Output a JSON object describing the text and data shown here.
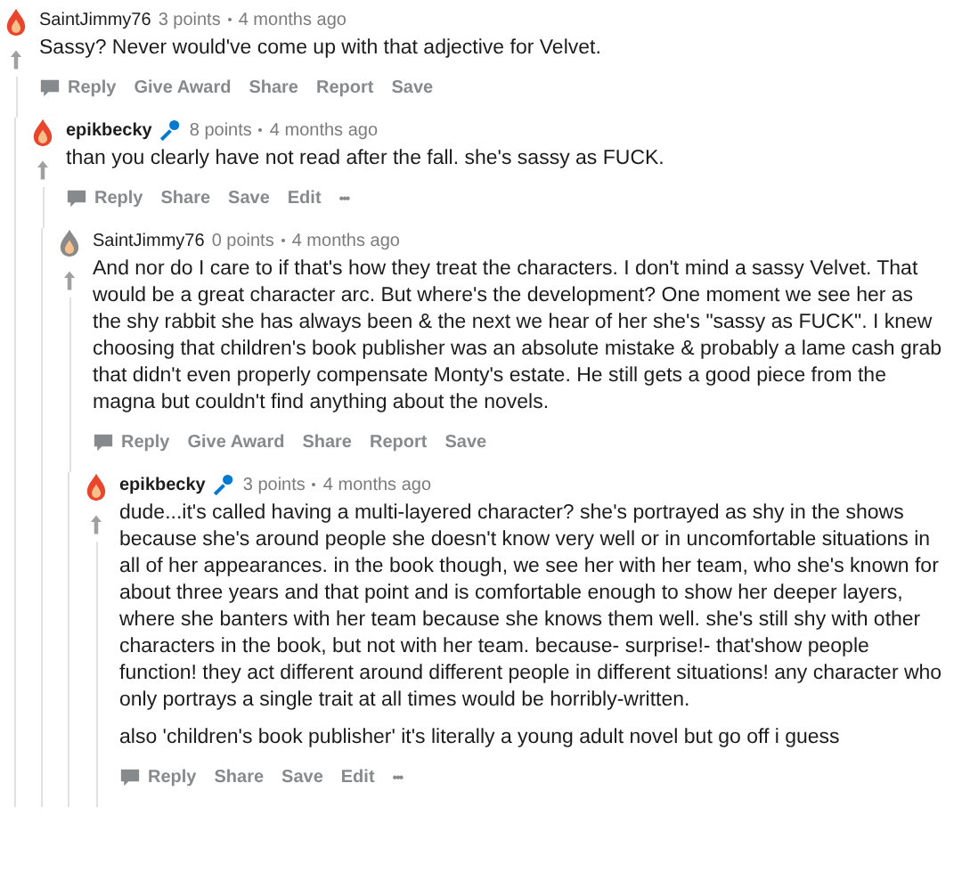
{
  "comments": [
    {
      "author": "SaintJimmy76",
      "is_op": false,
      "color": "#e8452c",
      "points": "3 points",
      "time": "4 months ago",
      "paragraphs": [
        "Sassy? Never would've come up with that adjective for Velvet."
      ],
      "actions": [
        {
          "kind": "reply",
          "label": "Reply"
        },
        {
          "kind": "text",
          "label": "Give Award"
        },
        {
          "kind": "text",
          "label": "Share"
        },
        {
          "kind": "text",
          "label": "Report"
        },
        {
          "kind": "text",
          "label": "Save"
        }
      ],
      "children": [
        {
          "author": "epikbecky",
          "is_op": true,
          "color": "#e8452c",
          "points": "8 points",
          "time": "4 months ago",
          "paragraphs": [
            "than you clearly have not read after the fall. she's sassy as FUCK."
          ],
          "actions": [
            {
              "kind": "reply",
              "label": "Reply"
            },
            {
              "kind": "text",
              "label": "Share"
            },
            {
              "kind": "text",
              "label": "Save"
            },
            {
              "kind": "text",
              "label": "Edit"
            },
            {
              "kind": "more",
              "label": "•••"
            }
          ],
          "children": [
            {
              "author": "SaintJimmy76",
              "is_op": false,
              "color": "#8a8a8a",
              "points": "0 points",
              "time": "4 months ago",
              "paragraphs": [
                "And nor do I care to if that's how they treat the characters. I don't mind a sassy Velvet. That would be a great character arc. But where's the development? One moment we see her as the shy rabbit she has always been & the next we hear of her she's \"sassy as FUCK\". I knew choosing that children's book publisher was an absolute mistake & probably a lame cash grab that didn't even properly compensate Monty's estate. He still gets a good piece from the magna but couldn't find anything about the novels."
              ],
              "actions": [
                {
                  "kind": "reply",
                  "label": "Reply"
                },
                {
                  "kind": "text",
                  "label": "Give Award"
                },
                {
                  "kind": "text",
                  "label": "Share"
                },
                {
                  "kind": "text",
                  "label": "Report"
                },
                {
                  "kind": "text",
                  "label": "Save"
                }
              ],
              "children": [
                {
                  "author": "epikbecky",
                  "is_op": true,
                  "points": "3 points",
                  "time": "4 months ago",
                  "paragraphs": [
                    "dude...it's called having a multi-layered character? she's portrayed as shy in the shows because she's around people she doesn't know very well or in uncomfortable situations in all of her appearances. in the book though, we see her with her team, who she's known for about three years and that point and is comfortable enough to show her deeper layers, where she banters with her team because she knows them well. she's still shy with other characters in the book, but not with her team. because- surprise!- that'show people function! they act different around different people in different situations! any character who only portrays a single trait at all times would be horribly-written.",
                    "also 'children's book publisher' it's literally a young adult novel but go off i guess"
                  ],
                  "actions": [
                    {
                      "kind": "reply",
                      "label": "Reply"
                    },
                    {
                      "kind": "text",
                      "label": "Share"
                    },
                    {
                      "kind": "text",
                      "label": "Save"
                    },
                    {
                      "kind": "text",
                      "label": "Edit"
                    },
                    {
                      "kind": "more",
                      "label": "•••"
                    }
                  ],
                  "color": "#e8452c"
                }
              ]
            }
          ]
        }
      ]
    }
  ]
}
